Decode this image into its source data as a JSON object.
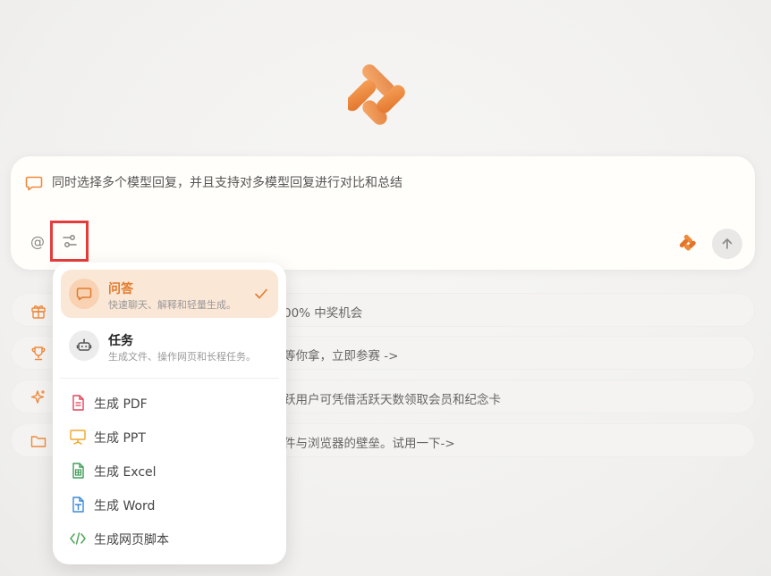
{
  "input": {
    "prompt_text": "同时选择多个模型回复，并且支持对多模型回复进行对比和总结",
    "at_symbol": "@"
  },
  "features": [
    {
      "icon": "gift-icon",
      "text": "00% 中奖机会"
    },
    {
      "icon": "trophy-icon",
      "text": "等你拿，立即参赛 ->"
    },
    {
      "icon": "sparkle-icon",
      "text": "跃用户可凭借活跃天数领取会员和纪念卡"
    },
    {
      "icon": "folder-icon",
      "text": "件与浏览器的壁垒。试用一下->"
    }
  ],
  "menu": {
    "modes": [
      {
        "title": "问答",
        "subtitle": "快速聊天、解释和轻量生成。",
        "selected": true,
        "icon": "chat-bubble-icon"
      },
      {
        "title": "任务",
        "subtitle": "生成文件、操作网页和长程任务。",
        "selected": false,
        "icon": "robot-icon"
      }
    ],
    "generators": [
      {
        "label": "生成 PDF",
        "icon": "pdf-file-icon",
        "color": "#e0455b"
      },
      {
        "label": "生成 PPT",
        "icon": "presentation-icon",
        "color": "#f0a52a"
      },
      {
        "label": "生成 Excel",
        "icon": "spreadsheet-icon",
        "color": "#3f9d58"
      },
      {
        "label": "生成 Word",
        "icon": "word-file-icon",
        "color": "#3a88d8"
      },
      {
        "label": "生成网页脚本",
        "icon": "code-icon",
        "color": "#4fa557"
      }
    ]
  },
  "colors": {
    "accent": "#ef8a3c",
    "selected_bg": "#fbe7d6",
    "highlight_border": "#e53b3b"
  }
}
